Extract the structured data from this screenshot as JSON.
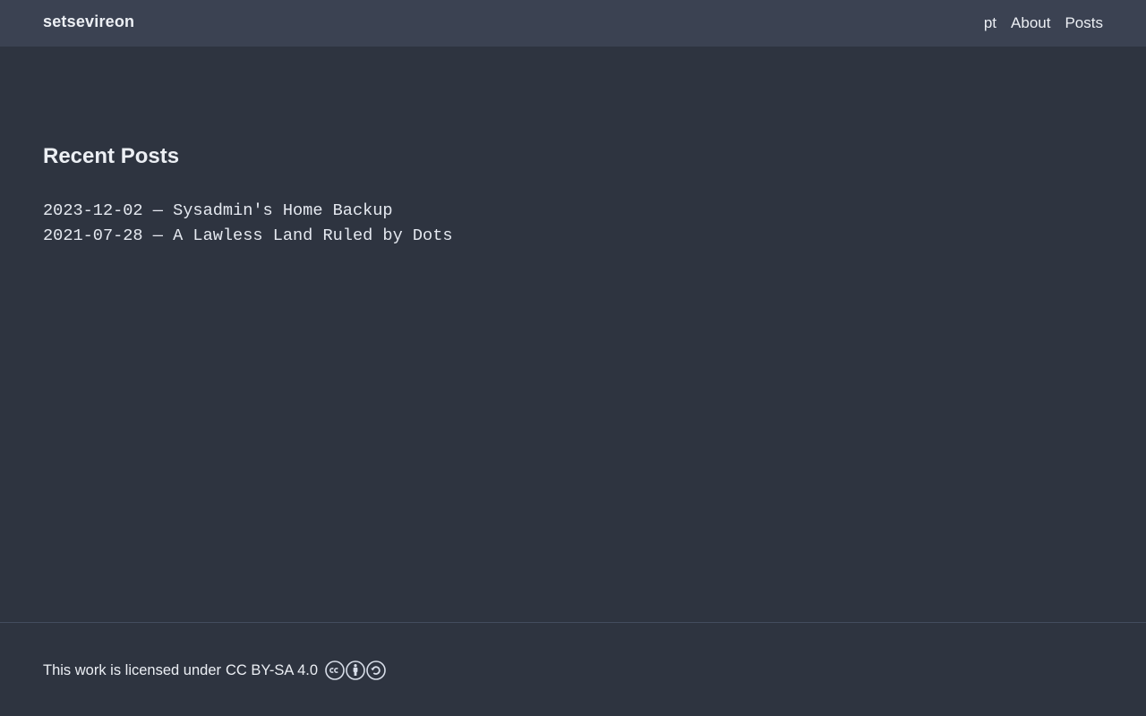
{
  "header": {
    "site_title": "setsevireon",
    "nav": [
      {
        "label": "pt"
      },
      {
        "label": "About"
      },
      {
        "label": "Posts"
      }
    ]
  },
  "main": {
    "section_title": "Recent Posts",
    "posts": [
      {
        "date": "2023-12-02",
        "separator": "—",
        "title": "Sysadmin's Home Backup"
      },
      {
        "date": "2021-07-28",
        "separator": "—",
        "title": "A Lawless Land Ruled by Dots"
      }
    ]
  },
  "footer": {
    "text": "This work is licensed under",
    "license_link": "CC BY-SA 4.0",
    "icons": [
      "cc-icon",
      "by-icon",
      "sa-icon"
    ]
  },
  "colors": {
    "background": "#2e3440",
    "header_background": "#3b4252",
    "text": "#eceff4"
  }
}
